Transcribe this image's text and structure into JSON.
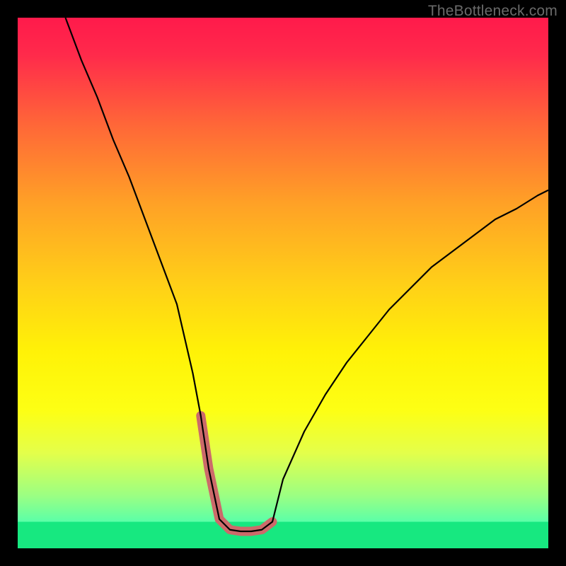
{
  "watermark": "TheBottleneck.com",
  "chart_data": {
    "type": "line",
    "title": "",
    "xlabel": "",
    "ylabel": "",
    "xlim": [
      0,
      100
    ],
    "ylim": [
      0,
      100
    ],
    "grid": false,
    "series": [
      {
        "name": "curve",
        "x": [
          9,
          12,
          15,
          18,
          21,
          24,
          27,
          30,
          33,
          34.5,
          36,
          38,
          40,
          42,
          44,
          46,
          48,
          50,
          54,
          58,
          62,
          66,
          70,
          74,
          78,
          82,
          86,
          90,
          94,
          98,
          100
        ],
        "values": [
          100,
          92,
          85,
          77,
          70,
          62,
          54,
          46,
          33,
          25,
          15,
          5.5,
          3.5,
          3.2,
          3.2,
          3.5,
          5,
          13,
          22,
          29,
          35,
          40,
          45,
          49,
          53,
          56,
          59,
          62,
          64,
          66.5,
          67.5
        ]
      },
      {
        "name": "highlight-segment",
        "x": [
          34.5,
          36,
          38,
          40,
          42,
          44,
          46,
          48
        ],
        "values": [
          25,
          15,
          5.5,
          3.5,
          3.2,
          3.2,
          3.5,
          5
        ]
      }
    ],
    "gradient": {
      "stops": [
        {
          "offset": 0.0,
          "color": "#ff1a4b"
        },
        {
          "offset": 0.07,
          "color": "#ff2a4b"
        },
        {
          "offset": 0.2,
          "color": "#ff6638"
        },
        {
          "offset": 0.35,
          "color": "#ffa126"
        },
        {
          "offset": 0.5,
          "color": "#ffcf18"
        },
        {
          "offset": 0.63,
          "color": "#fff207"
        },
        {
          "offset": 0.74,
          "color": "#fdff14"
        },
        {
          "offset": 0.82,
          "color": "#e4ff4a"
        },
        {
          "offset": 0.9,
          "color": "#9cff82"
        },
        {
          "offset": 0.96,
          "color": "#4effb0"
        },
        {
          "offset": 1.0,
          "color": "#17e880"
        }
      ]
    },
    "green_band": {
      "y0": 0,
      "y1": 5
    },
    "highlight_style": {
      "color": "#cc6a6a",
      "width": 13,
      "cap": "round"
    },
    "curve_style": {
      "color": "#000000",
      "width": 2.2
    }
  }
}
